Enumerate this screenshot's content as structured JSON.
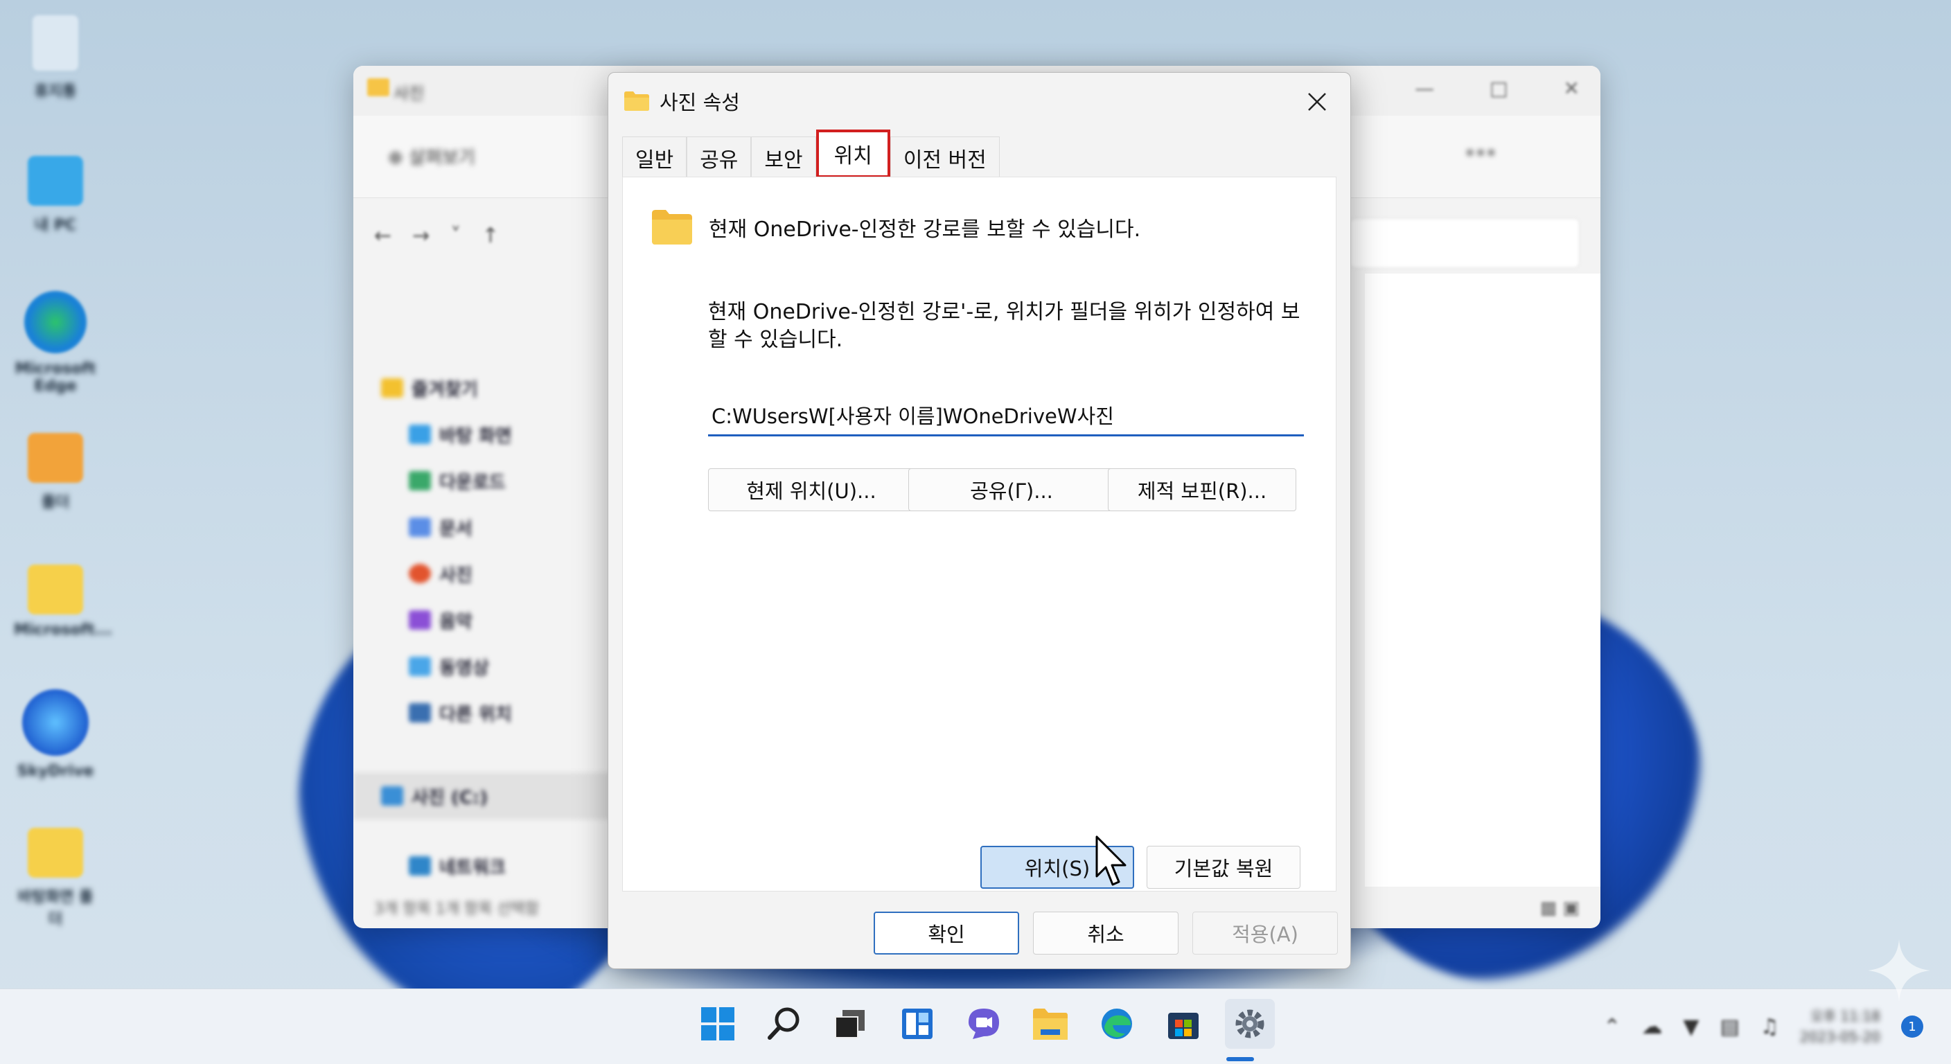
{
  "dialog": {
    "title": "사진 속성",
    "tabs": [
      "일반",
      "공유",
      "보안",
      "위치",
      "이전 버전"
    ],
    "active_tab": "위치",
    "info_text": "현재 OneDrive-인정한 강로를 보할 수 있습니다.",
    "description": "현재 OneDrive-인정힌 강로'-로, 위치가 필더을 위히가 인정하여 보할 수 있습니다.",
    "path_value": "C:WUsersW[사용자 이름]WOneDriveW사진",
    "buttons": {
      "current_location": "현제 위치(U)...",
      "share": "공유(Γ)...",
      "target_find": "제적 보핀(R)...",
      "location": "위치(S)",
      "restore_default": "기본값 복원",
      "ok": "확인",
      "cancel": "취소",
      "apply": "적용(A)"
    }
  },
  "explorer": {
    "title": "사진",
    "toolbar_new": "살펴보기",
    "nav_items": [
      "즐겨찾기",
      "바탕 화면",
      "다운로드",
      "문서",
      "사진",
      "음악",
      "동영상",
      "다른 위치"
    ],
    "nav_selected": "사진 (C:)",
    "nav_network": "네트워크",
    "status": "3개 항목   1개 항목 선택함"
  },
  "desktop_icons": [
    "휴지통",
    "내 PC",
    "Microsoft Edge",
    "폴더",
    "Microsoft...",
    "SkyDrive",
    "바탕화면 폴더"
  ],
  "taskbar": {
    "clock_time": "오후 11:18",
    "clock_date": "2023-05-20",
    "notification_count": "1",
    "icons": [
      "start-icon",
      "search-icon",
      "task-view-icon",
      "widgets-icon",
      "chat-icon",
      "file-explorer-icon",
      "edge-icon",
      "store-icon",
      "settings-icon"
    ]
  },
  "colors": {
    "accent": "#1f5fbf",
    "highlight_border": "#d21f1f",
    "folder": "#f6c446"
  }
}
